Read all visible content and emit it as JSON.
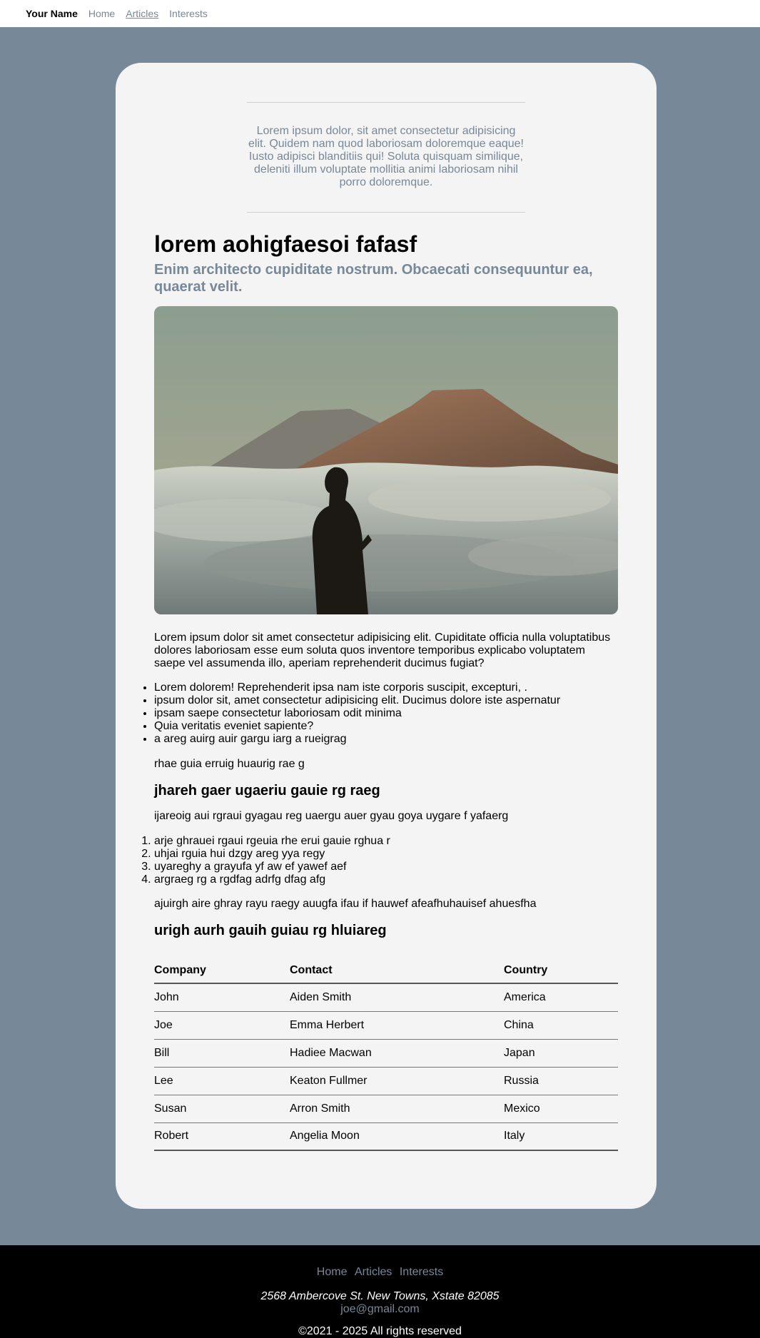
{
  "nav": {
    "brand": "Your Name",
    "links": [
      "Home",
      "Articles",
      "Interests"
    ],
    "active": "Articles"
  },
  "quote": "Lorem ipsum dolor, sit amet consectetur adipisicing elit. Quidem nam quod laboriosam doloremque eaque! Iusto adipisci blanditiis qui! Soluta quisquam similique, deleniti illum voluptate mollitia animi laboriosam nihil porro doloremque.",
  "article": {
    "title": "lorem aohigfaesoi fafasf",
    "subtitle": "Enim architecto cupiditate nostrum. Obcaecati consequuntur ea, quaerat velit.",
    "intro": "Lorem ipsum dolor sit amet consectetur adipisicing elit. Cupiditate officia nulla voluptatibus dolores laboriosam esse eum soluta quos inventore temporibus explicabo voluptatem saepe vel assumenda illo, aperiam reprehenderit ducimus fugiat?",
    "bullets": [
      "Lorem dolorem! Reprehenderit ipsa nam iste corporis suscipit, excepturi, .",
      "ipsum dolor sit, amet consectetur adipisicing elit. Ducimus dolore iste aspernatur",
      "ipsam saepe consectetur laboriosam odit minima",
      "Quia veritatis eveniet sapiente?",
      "a areg auirg auir gargu iarg a rueigrag"
    ],
    "para2": "rhae guia erruig huaurig rae g",
    "heading2": "jhareh gaer ugaeriu gauie rg raeg",
    "para3": "ijareoig aui rgraui gyagau reg uaergu auer gyau goya uygare f yafaerg",
    "numbered": [
      "arje ghrauei rgaui rgeuia rhe erui gauie rghua r",
      "uhjai rguia hui dzgy areg yya regy",
      "uyareghy a grayufa yf aw ef yawef aef",
      "argraeg rg a rgdfag adrfg dfag afg"
    ],
    "para4": "ajuirgh aire ghray rayu raegy auugfa ifau if hauwef afeafhuhauisef ahuesfha",
    "heading3": "urigh aurh gauih guiau rg hluiareg"
  },
  "table": {
    "headers": [
      "Company",
      "Contact",
      "Country"
    ],
    "rows": [
      [
        "John",
        "Aiden Smith",
        "America"
      ],
      [
        "Joe",
        "Emma Herbert",
        "China"
      ],
      [
        "Bill",
        "Hadiee Macwan",
        "Japan"
      ],
      [
        "Lee",
        "Keaton Fullmer",
        "Russia"
      ],
      [
        "Susan",
        "Arron Smith",
        "Mexico"
      ],
      [
        "Robert",
        "Angelia Moon",
        "Italy"
      ]
    ]
  },
  "footer": {
    "links": [
      "Home",
      "Articles",
      "Interests"
    ],
    "address": "2568 Ambercove St. New Towns, Xstate 82085",
    "email": "joe@gmail.com",
    "copyright": "©2021 - 2025 All rights reserved"
  },
  "colors": {
    "background": "#778899",
    "card": "#f3f4f3",
    "accent": "#778899",
    "footer": "#000000"
  }
}
